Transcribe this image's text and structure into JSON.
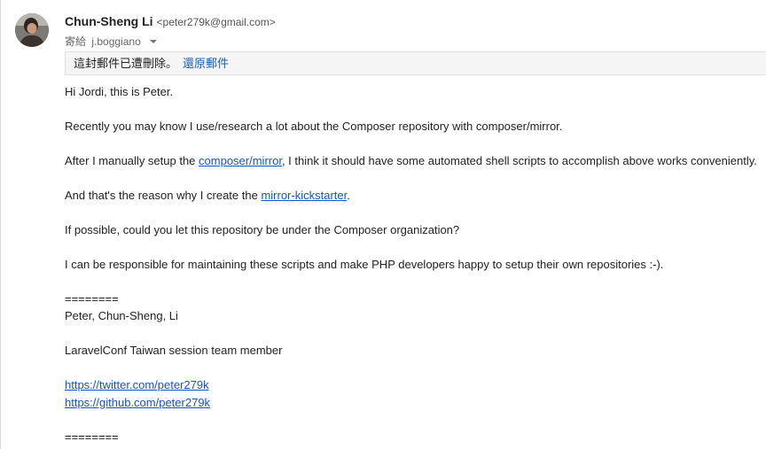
{
  "sender": {
    "name": "Chun-Sheng Li",
    "email": "<peter279k@gmail.com>",
    "to_label": "寄給",
    "to_name": "j.boggiano"
  },
  "notice": {
    "text": "這封郵件已遭刪除。",
    "undo_link": "還原郵件"
  },
  "message": {
    "greeting": "Hi Jordi, this is Peter.",
    "p1": "Recently you may know I use/research a lot about the Composer repository with composer/mirror.",
    "p2_before": "After I manually setup the ",
    "p2_link": "composer/mirror",
    "p2_after": ", I think it should have some automated shell scripts to accomplish above works conveniently.",
    "p3_before": "And that's the reason why I create the ",
    "p3_link": "mirror-kickstarter",
    "p3_after": ".",
    "p4": "If possible, could you let this repository be under the Composer organization?",
    "p5": "I can be responsible for maintaining these scripts and make PHP developers happy to setup their own repositories :-).",
    "separator1": "========",
    "signature_name": "Peter, Chun-Sheng, Li",
    "signature_role": "LaravelConf Taiwan session team member",
    "twitter_link": "https://twitter.com/peter279k",
    "github_link": "https://github.com/peter279k",
    "separator2": "========"
  }
}
